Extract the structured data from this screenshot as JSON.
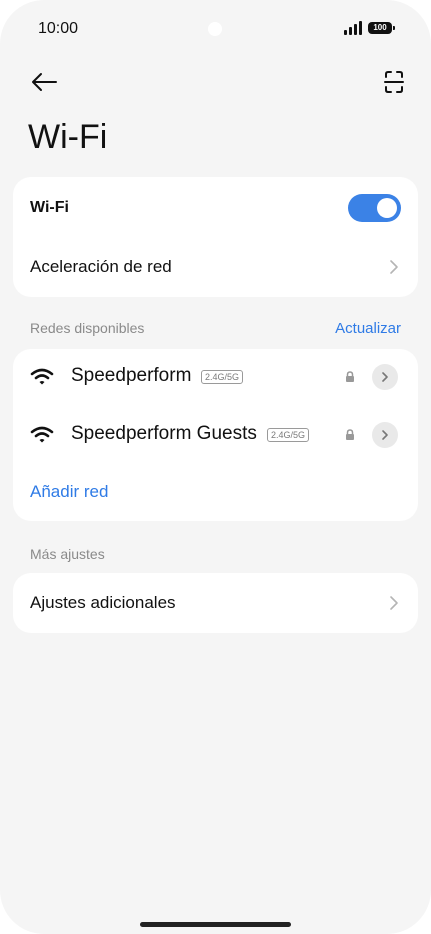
{
  "status_bar": {
    "time": "10:00",
    "battery": "100"
  },
  "header": {
    "title": "Wi-Fi"
  },
  "main_card": {
    "wifi_label": "Wi-Fi",
    "wifi_enabled": true,
    "acceleration_label": "Aceleración de red"
  },
  "networks_section": {
    "label": "Redes disponibles",
    "refresh_label": "Actualizar",
    "networks": [
      {
        "name": "Speedperform",
        "band": "2.4G/5G",
        "secured": true
      },
      {
        "name": "Speedperform Guests",
        "band": "2.4G/5G",
        "secured": true
      }
    ],
    "add_network_label": "Añadir red"
  },
  "more_section": {
    "label": "Más ajustes",
    "additional_label": "Ajustes adicionales"
  },
  "colors": {
    "accent": "#3b82e6",
    "link": "#2f7be6",
    "background": "#f5f5f5"
  }
}
